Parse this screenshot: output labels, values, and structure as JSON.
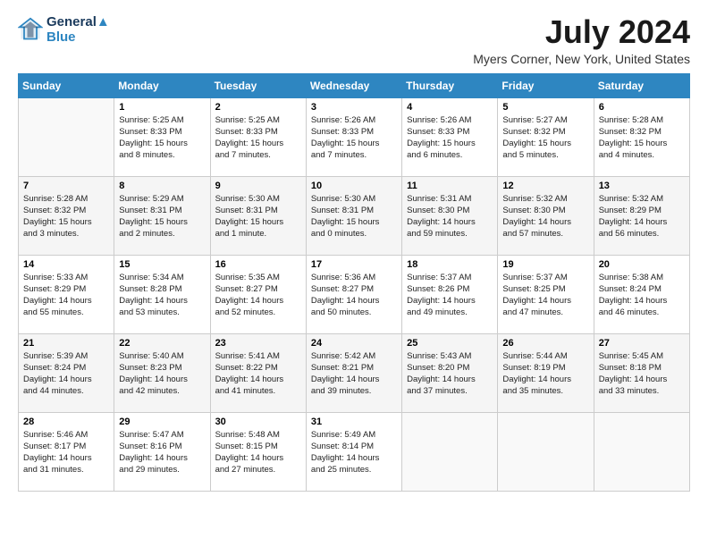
{
  "header": {
    "logo_line1": "General",
    "logo_line2": "Blue",
    "month": "July 2024",
    "location": "Myers Corner, New York, United States"
  },
  "weekdays": [
    "Sunday",
    "Monday",
    "Tuesday",
    "Wednesday",
    "Thursday",
    "Friday",
    "Saturday"
  ],
  "weeks": [
    [
      {
        "day": "",
        "info": ""
      },
      {
        "day": "1",
        "info": "Sunrise: 5:25 AM\nSunset: 8:33 PM\nDaylight: 15 hours\nand 8 minutes."
      },
      {
        "day": "2",
        "info": "Sunrise: 5:25 AM\nSunset: 8:33 PM\nDaylight: 15 hours\nand 7 minutes."
      },
      {
        "day": "3",
        "info": "Sunrise: 5:26 AM\nSunset: 8:33 PM\nDaylight: 15 hours\nand 7 minutes."
      },
      {
        "day": "4",
        "info": "Sunrise: 5:26 AM\nSunset: 8:33 PM\nDaylight: 15 hours\nand 6 minutes."
      },
      {
        "day": "5",
        "info": "Sunrise: 5:27 AM\nSunset: 8:32 PM\nDaylight: 15 hours\nand 5 minutes."
      },
      {
        "day": "6",
        "info": "Sunrise: 5:28 AM\nSunset: 8:32 PM\nDaylight: 15 hours\nand 4 minutes."
      }
    ],
    [
      {
        "day": "7",
        "info": "Sunrise: 5:28 AM\nSunset: 8:32 PM\nDaylight: 15 hours\nand 3 minutes."
      },
      {
        "day": "8",
        "info": "Sunrise: 5:29 AM\nSunset: 8:31 PM\nDaylight: 15 hours\nand 2 minutes."
      },
      {
        "day": "9",
        "info": "Sunrise: 5:30 AM\nSunset: 8:31 PM\nDaylight: 15 hours\nand 1 minute."
      },
      {
        "day": "10",
        "info": "Sunrise: 5:30 AM\nSunset: 8:31 PM\nDaylight: 15 hours\nand 0 minutes."
      },
      {
        "day": "11",
        "info": "Sunrise: 5:31 AM\nSunset: 8:30 PM\nDaylight: 14 hours\nand 59 minutes."
      },
      {
        "day": "12",
        "info": "Sunrise: 5:32 AM\nSunset: 8:30 PM\nDaylight: 14 hours\nand 57 minutes."
      },
      {
        "day": "13",
        "info": "Sunrise: 5:32 AM\nSunset: 8:29 PM\nDaylight: 14 hours\nand 56 minutes."
      }
    ],
    [
      {
        "day": "14",
        "info": "Sunrise: 5:33 AM\nSunset: 8:29 PM\nDaylight: 14 hours\nand 55 minutes."
      },
      {
        "day": "15",
        "info": "Sunrise: 5:34 AM\nSunset: 8:28 PM\nDaylight: 14 hours\nand 53 minutes."
      },
      {
        "day": "16",
        "info": "Sunrise: 5:35 AM\nSunset: 8:27 PM\nDaylight: 14 hours\nand 52 minutes."
      },
      {
        "day": "17",
        "info": "Sunrise: 5:36 AM\nSunset: 8:27 PM\nDaylight: 14 hours\nand 50 minutes."
      },
      {
        "day": "18",
        "info": "Sunrise: 5:37 AM\nSunset: 8:26 PM\nDaylight: 14 hours\nand 49 minutes."
      },
      {
        "day": "19",
        "info": "Sunrise: 5:37 AM\nSunset: 8:25 PM\nDaylight: 14 hours\nand 47 minutes."
      },
      {
        "day": "20",
        "info": "Sunrise: 5:38 AM\nSunset: 8:24 PM\nDaylight: 14 hours\nand 46 minutes."
      }
    ],
    [
      {
        "day": "21",
        "info": "Sunrise: 5:39 AM\nSunset: 8:24 PM\nDaylight: 14 hours\nand 44 minutes."
      },
      {
        "day": "22",
        "info": "Sunrise: 5:40 AM\nSunset: 8:23 PM\nDaylight: 14 hours\nand 42 minutes."
      },
      {
        "day": "23",
        "info": "Sunrise: 5:41 AM\nSunset: 8:22 PM\nDaylight: 14 hours\nand 41 minutes."
      },
      {
        "day": "24",
        "info": "Sunrise: 5:42 AM\nSunset: 8:21 PM\nDaylight: 14 hours\nand 39 minutes."
      },
      {
        "day": "25",
        "info": "Sunrise: 5:43 AM\nSunset: 8:20 PM\nDaylight: 14 hours\nand 37 minutes."
      },
      {
        "day": "26",
        "info": "Sunrise: 5:44 AM\nSunset: 8:19 PM\nDaylight: 14 hours\nand 35 minutes."
      },
      {
        "day": "27",
        "info": "Sunrise: 5:45 AM\nSunset: 8:18 PM\nDaylight: 14 hours\nand 33 minutes."
      }
    ],
    [
      {
        "day": "28",
        "info": "Sunrise: 5:46 AM\nSunset: 8:17 PM\nDaylight: 14 hours\nand 31 minutes."
      },
      {
        "day": "29",
        "info": "Sunrise: 5:47 AM\nSunset: 8:16 PM\nDaylight: 14 hours\nand 29 minutes."
      },
      {
        "day": "30",
        "info": "Sunrise: 5:48 AM\nSunset: 8:15 PM\nDaylight: 14 hours\nand 27 minutes."
      },
      {
        "day": "31",
        "info": "Sunrise: 5:49 AM\nSunset: 8:14 PM\nDaylight: 14 hours\nand 25 minutes."
      },
      {
        "day": "",
        "info": ""
      },
      {
        "day": "",
        "info": ""
      },
      {
        "day": "",
        "info": ""
      }
    ]
  ]
}
